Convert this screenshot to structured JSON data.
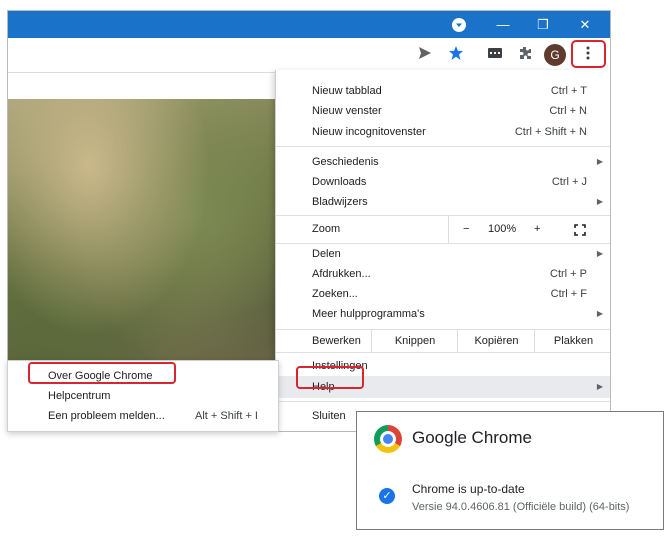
{
  "window": {
    "controls": {
      "minimize": "—",
      "maximize": "❐",
      "close": "✕"
    }
  },
  "toolbar": {
    "avatar_initial": "G",
    "icons": [
      "send-icon",
      "star-icon",
      "media-icon",
      "extensions-icon",
      "menu-dots-icon"
    ]
  },
  "menu": {
    "items": {
      "new_tab": {
        "label": "Nieuw tabblad",
        "shortcut": "Ctrl + T"
      },
      "new_window": {
        "label": "Nieuw venster",
        "shortcut": "Ctrl + N"
      },
      "incognito": {
        "label": "Nieuw incognitovenster",
        "shortcut": "Ctrl + Shift + N"
      },
      "history": {
        "label": "Geschiedenis"
      },
      "downloads": {
        "label": "Downloads",
        "shortcut": "Ctrl + J"
      },
      "bookmarks": {
        "label": "Bladwijzers"
      },
      "zoom": {
        "label": "Zoom",
        "minus": "−",
        "value": "100%",
        "plus": "+"
      },
      "share": {
        "label": "Delen"
      },
      "print": {
        "label": "Afdrukken...",
        "shortcut": "Ctrl + P"
      },
      "find": {
        "label": "Zoeken...",
        "shortcut": "Ctrl + F"
      },
      "more_tools": {
        "label": "Meer hulpprogramma's"
      },
      "edit": {
        "label": "Bewerken",
        "cut": "Knippen",
        "copy": "Kopiëren",
        "paste": "Plakken"
      },
      "settings": {
        "label": "Instellingen"
      },
      "help": {
        "label": "Help"
      },
      "exit": {
        "label": "Sluiten"
      }
    }
  },
  "help_submenu": {
    "about": {
      "label": "Over Google Chrome"
    },
    "help_center": {
      "label": "Helpcentrum"
    },
    "report": {
      "label": "Een probleem melden...",
      "shortcut": "Alt + Shift + I"
    }
  },
  "about_dialog": {
    "title": "Google Chrome",
    "status": "Chrome is up-to-date",
    "version": "Versie 94.0.4606.81 (Officiële build) (64-bits)"
  },
  "colors": {
    "titlebar": "#1a73c8",
    "highlight": "#d8262f",
    "check": "#1a73e8"
  }
}
